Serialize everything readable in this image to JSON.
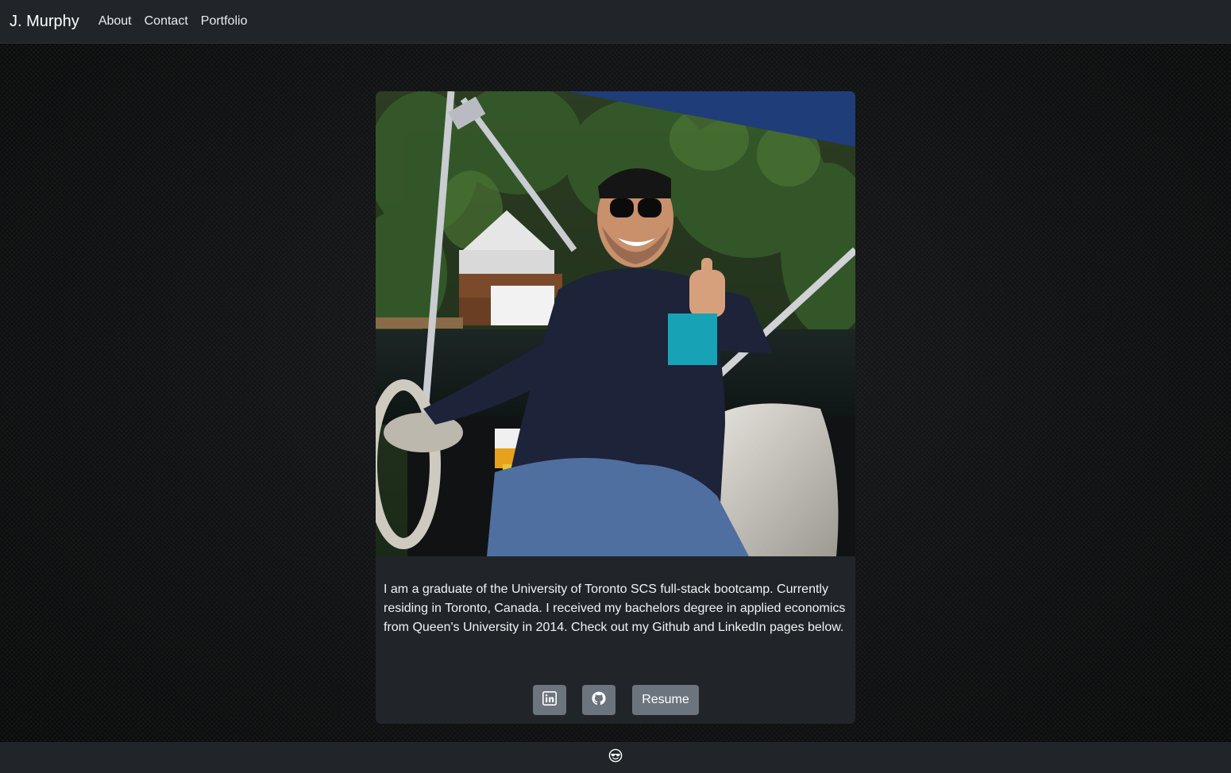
{
  "navbar": {
    "brand": "J. Murphy",
    "links": [
      "About",
      "Contact",
      "Portfolio"
    ]
  },
  "card": {
    "image_alt_icon": "profile-photo",
    "bio": "I am a graduate of the University of Toronto SCS full-stack bootcamp. Currently residing in Toronto, Canada. I received my bachelors degree in applied economics from Queen's University in 2014. Check out my Github and LinkedIn pages below.",
    "buttons": {
      "linkedin_icon": "linkedin-icon",
      "github_icon": "github-icon",
      "resume_label": "Resume"
    }
  },
  "footer": {
    "icon": "sunglasses-face-icon"
  },
  "colors": {
    "navbar_bg": "#212529",
    "card_bg": "#212529",
    "button_bg": "#6c757d",
    "page_bg": "#121314"
  }
}
